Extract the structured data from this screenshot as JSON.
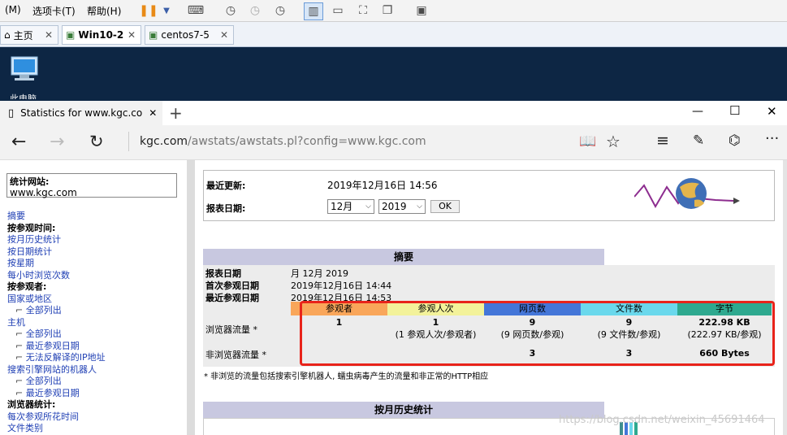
{
  "host_menu": {
    "items": [
      "(M)",
      "选项卡(T)",
      "帮助(H)"
    ]
  },
  "host_tabs": [
    {
      "label": "主页",
      "icon": "home-icon"
    },
    {
      "label": "Win10-2",
      "icon": "vm-icon"
    },
    {
      "label": "centos7-5",
      "icon": "vm-icon"
    }
  ],
  "desktop": {
    "icon_label": "此电脑"
  },
  "edge": {
    "tab_title": "Statistics for www.kgc.co",
    "url_host": "kgc.com",
    "url_rest": "/awstats/awstats.pl?config=www.kgc.com"
  },
  "sidebar": {
    "site_label": "统计网站:",
    "site_value": "www.kgc.com",
    "items": [
      {
        "text": "摘要",
        "type": "link",
        "indent": 0
      },
      {
        "text": "按参观时间:",
        "type": "head",
        "indent": 0
      },
      {
        "text": "按月历史统计",
        "type": "link",
        "indent": 0
      },
      {
        "text": "按日期统计",
        "type": "link",
        "indent": 0
      },
      {
        "text": "按星期",
        "type": "link",
        "indent": 0
      },
      {
        "text": "每小时浏览次数",
        "type": "link",
        "indent": 0
      },
      {
        "text": "按参观者:",
        "type": "head",
        "indent": 0
      },
      {
        "text": "国家或地区",
        "type": "link",
        "indent": 0
      },
      {
        "text": "全部列出",
        "type": "link",
        "indent": 1
      },
      {
        "text": "主机",
        "type": "link",
        "indent": 0
      },
      {
        "text": "全部列出",
        "type": "link",
        "indent": 1
      },
      {
        "text": "最近参观日期",
        "type": "link",
        "indent": 1
      },
      {
        "text": "无法反解译的IP地址",
        "type": "link",
        "indent": 1
      },
      {
        "text": "搜索引擎网站的机器人",
        "type": "link",
        "indent": 0
      },
      {
        "text": "全部列出",
        "type": "link",
        "indent": 1
      },
      {
        "text": "最近参观日期",
        "type": "link",
        "indent": 1
      },
      {
        "text": "浏览器统计:",
        "type": "head",
        "indent": 0
      },
      {
        "text": "每次参观所花时间",
        "type": "link",
        "indent": 0
      },
      {
        "text": "文件类别",
        "type": "link",
        "indent": 0
      }
    ]
  },
  "main": {
    "last_update_label": "最近更新:",
    "last_update_value": "2019年12月16日 14:56",
    "report_date_label": "报表日期:",
    "month_selected": "12月",
    "year_selected": "2019",
    "ok_label": "OK",
    "summary": {
      "title": "摘要",
      "report_date_label": "报表日期",
      "report_date_value": "月 12月 2019",
      "first_visit_label": "首次参观日期",
      "first_visit_value": "2019年12月16日 14:44",
      "last_visit_label": "最近参观日期",
      "last_visit_value": "2019年12月16日 14:53",
      "columns": [
        {
          "label": "参观者",
          "color": "#f9a65a"
        },
        {
          "label": "参观人次",
          "color": "#f3f29a"
        },
        {
          "label": "网页数",
          "color": "#4476d8"
        },
        {
          "label": "文件数",
          "color": "#6ad8ec"
        },
        {
          "label": "字节",
          "color": "#2ea98f"
        }
      ],
      "browser_row_label": "浏览器流量 *",
      "browser_values": [
        "1",
        "1",
        "9",
        "9",
        "222.98 KB"
      ],
      "browser_sub": [
        "",
        "(1 参观人次/参观者)",
        "(9 网页数/参观)",
        "(9 文件数/参观)",
        "(222.97 KB/参观)"
      ],
      "nonbrowser_row_label": "非浏览器流量 *",
      "nonbrowser_values": [
        "",
        "",
        "3",
        "3",
        "660 Bytes"
      ],
      "footnote": "* 非浏览的流量包括搜索引擎机器人, 蠕虫病毒产生的流量和非正常的HTTP相应"
    },
    "monthly_title": "按月历史统计"
  },
  "watermark": "https://blog.csdn.net/weixin_45691464",
  "highlight_color": "#e8231a"
}
